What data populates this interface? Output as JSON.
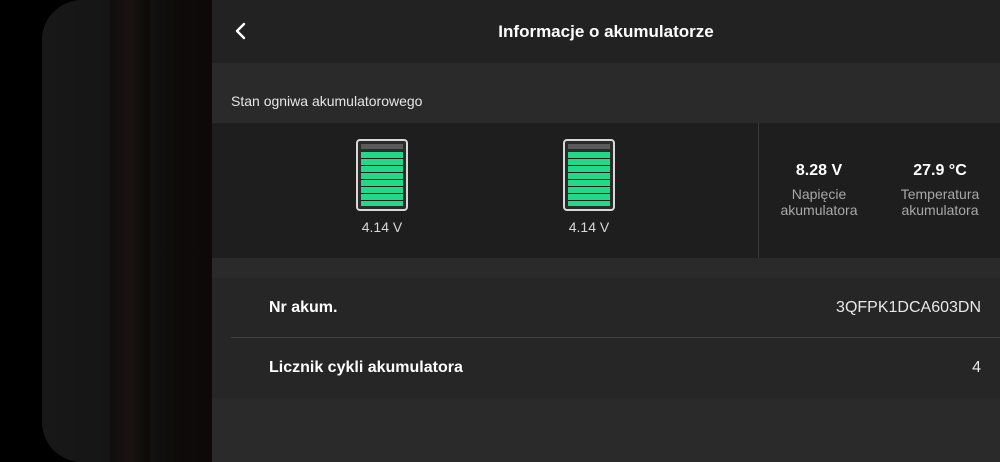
{
  "header": {
    "title": "Informacje o akumulatorze",
    "back_icon": "chevron-left-icon"
  },
  "cells_section": {
    "label": "Stan ogniwa akumulatorowego",
    "cells": [
      {
        "voltage": "4.14 V",
        "level": 1.0
      },
      {
        "voltage": "4.14 V",
        "level": 1.0
      }
    ],
    "fill_color": "#22d98a"
  },
  "stats": {
    "voltage": {
      "value": "8.28 V",
      "label_line1": "Napięcie",
      "label_line2": "akumulatora"
    },
    "temperature": {
      "value": "27.9 °C",
      "label_line1": "Temperatura",
      "label_line2": "akumulatora"
    }
  },
  "info": {
    "rows": [
      {
        "key": "Nr akum.",
        "value": "3QFPK1DCA603DN"
      },
      {
        "key": "Licznik cykli akumulatora",
        "value": "4"
      }
    ]
  }
}
